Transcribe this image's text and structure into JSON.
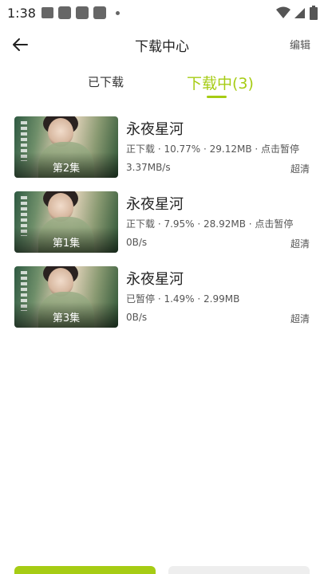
{
  "status_bar": {
    "time": "1:38",
    "icons_left": [
      "image-icon",
      "app-icon",
      "app-icon",
      "app-icon",
      "dot-icon"
    ],
    "icons_right": [
      "wifi-icon",
      "signal-icon",
      "battery-icon"
    ]
  },
  "header": {
    "title": "下载中心",
    "edit_label": "编辑"
  },
  "tabs": {
    "downloaded": "已下载",
    "downloading": "下载中(3)",
    "active_color": "#a6cc14"
  },
  "items": [
    {
      "title": "永夜星河",
      "episode": "第2集",
      "status": "正下载 · 10.77% · 29.12MB · 点击暂停",
      "speed": "3.37MB/s",
      "quality": "超清"
    },
    {
      "title": "永夜星河",
      "episode": "第1集",
      "status": "正下载 · 7.95% · 28.92MB · 点击暂停",
      "speed": "0B/s",
      "quality": "超清"
    },
    {
      "title": "永夜星河",
      "episode": "第3集",
      "status": "已暂停 · 1.49% · 2.99MB",
      "speed": "0B/s",
      "quality": "超清"
    }
  ],
  "colors": {
    "accent": "#a6cc14",
    "secondary_button": "#eeeeee"
  }
}
